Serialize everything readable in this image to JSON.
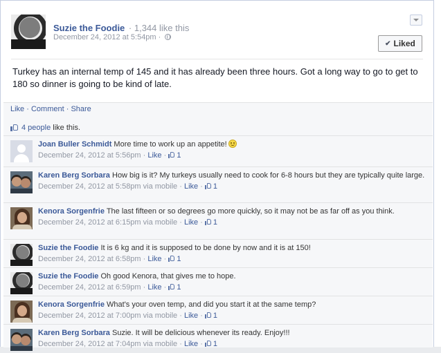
{
  "post": {
    "author": "Suzie the Foodie",
    "like_count": "· 1,344 like this",
    "date": "December 24, 2012 at 5:54pm ·",
    "liked_label": "Liked",
    "text": "Turkey has an internal temp of 145 and it has already been three hours. Got a long way to go to get to 180 so dinner is going to be kind of late.",
    "actions": {
      "like": "Like",
      "sep": " · ",
      "comment": "Comment",
      "share": "Share"
    }
  },
  "likes": {
    "link": "4 people",
    "suffix": " like this."
  },
  "comments": [
    {
      "author": "Joan Buller Schmidt",
      "avatar": "blank",
      "text": "More time to work up an appetite!",
      "emoji": true,
      "date": "December 24, 2012 at 5:56pm",
      "via": "",
      "like": "Like",
      "count": "1"
    },
    {
      "author": "Karen Berg Sorbara",
      "avatar": "karen",
      "text": "How big is it? My turkeys usually need to cook for 6-8 hours but they are typically quite large.",
      "emoji": false,
      "date": "December 24, 2012 at 5:58pm",
      "via": " via mobile",
      "like": "Like",
      "count": "1"
    },
    {
      "author": "Kenora Sorgenfrie",
      "avatar": "kenora",
      "text": "The last fifteen or so degrees go more quickly, so it may not be as far off as you think.",
      "emoji": false,
      "date": "December 24, 2012 at 6:15pm",
      "via": " via mobile",
      "like": "Like",
      "count": "1"
    },
    {
      "author": "Suzie the Foodie",
      "avatar": "suzie",
      "text": "It is 6 kg and it is supposed to be done by now and it is at 150!",
      "emoji": false,
      "date": "December 24, 2012 at 6:58pm",
      "via": "",
      "like": "Like",
      "count": "1"
    },
    {
      "author": "Suzie the Foodie",
      "avatar": "suzie",
      "text": "Oh good Kenora, that gives me to hope.",
      "emoji": false,
      "date": "December 24, 2012 at 6:59pm",
      "via": "",
      "like": "Like",
      "count": "1"
    },
    {
      "author": "Kenora Sorgenfrie",
      "avatar": "kenora",
      "text": "What's your oven temp, and did you start it at the same temp?",
      "emoji": false,
      "date": "December 24, 2012 at 7:00pm",
      "via": " via mobile",
      "like": "Like",
      "count": "1"
    },
    {
      "author": "Karen Berg Sorbara",
      "avatar": "karen",
      "text": "Suzie. It will be delicious whenever its ready. Enjoy!!!",
      "emoji": false,
      "date": "December 24, 2012 at 7:04pm",
      "via": " via mobile",
      "like": "Like",
      "count": "1"
    }
  ],
  "colors": {
    "link": "#3b5998",
    "muted": "#9197a3",
    "ufi_bg": "#f6f7f9"
  }
}
